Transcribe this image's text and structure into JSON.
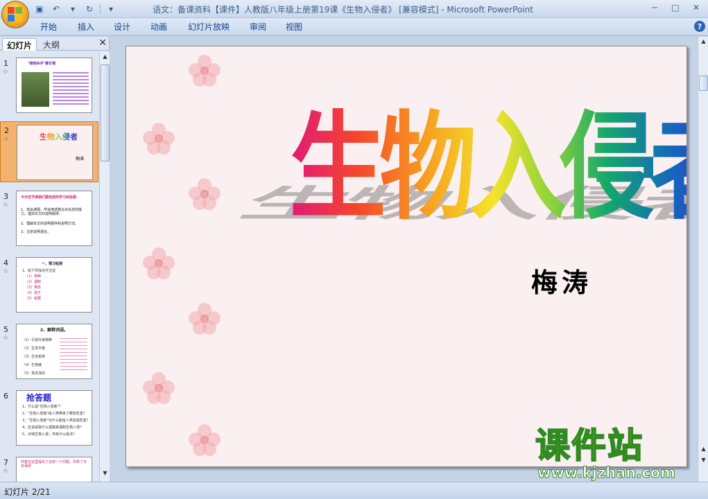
{
  "window": {
    "title": "语文：备课资料【课件】人教版八年级上册第19课《生物入侵者》 [兼容模式] - Microsoft PowerPoint",
    "controls": [
      "─",
      "□",
      "✕"
    ]
  },
  "ribbon": {
    "tabs": [
      "开始",
      "插入",
      "设计",
      "动画",
      "幻灯片放映",
      "审阅",
      "视图"
    ],
    "help": "?"
  },
  "leftpane": {
    "tabs": [
      "幻灯片",
      "大纲"
    ],
    "close": "✕",
    "thumbnails": [
      {
        "number": "1",
        "title": "\"植物杀手\"薇甘菊"
      },
      {
        "number": "2",
        "title": "生物入侵者",
        "author": "梅涛"
      },
      {
        "number": "3",
        "title": "今天这节课我们要完成的学习目标是：",
        "lines": [
          "1、体会课题，学会筛选整合出信息的能力。理清本文的说明顺序。",
          "2、理解本文的说明顺序和说明方法。",
          "3、注意说明语言。"
        ]
      },
      {
        "number": "4",
        "title": "一、预习检测",
        "lines": [
          "1、给下列加点字注音",
          "（1）物种",
          "（2）遏制",
          "（3）栖息",
          "（4）毁于",
          "（5）蚁群"
        ]
      },
      {
        "number": "5",
        "title": "2、解释词语。",
        "lines": [
          "（1）引进外来物种",
          "（2）生态平衡",
          "（3）生态系统",
          "（4）生物链",
          "（5）变本加厉"
        ]
      },
      {
        "number": "6",
        "title": "抢答题",
        "lines": [
          "1、什么是\"生物入侵者\"？",
          "2、\"生物入侵者\"给人类带来了哪些危害？",
          "3、\"生物入侵者\"为什么能给人类造成危害？",
          "4、应该采取什么措施来遏制生物入侵？",
          "5、对待生物入侵，你有什么看法？"
        ]
      },
      {
        "number": "7",
        "lines": [
          "作者在这里提出了这样一个问题，列举了许多事例"
        ]
      }
    ],
    "star": "☆"
  },
  "slide": {
    "title": "生物入侵者",
    "author": "梅涛"
  },
  "statusbar": {
    "text": "幻灯片 2/21"
  },
  "watermark": {
    "main": "课件站",
    "url": "www.kjzhan.com"
  },
  "colors": {
    "title_gradient": [
      "#e01978",
      "#f5462c",
      "#f79e20",
      "#f6e32c",
      "#8cd23a",
      "#13a86b",
      "#1564c0",
      "#5a1fb5"
    ]
  }
}
